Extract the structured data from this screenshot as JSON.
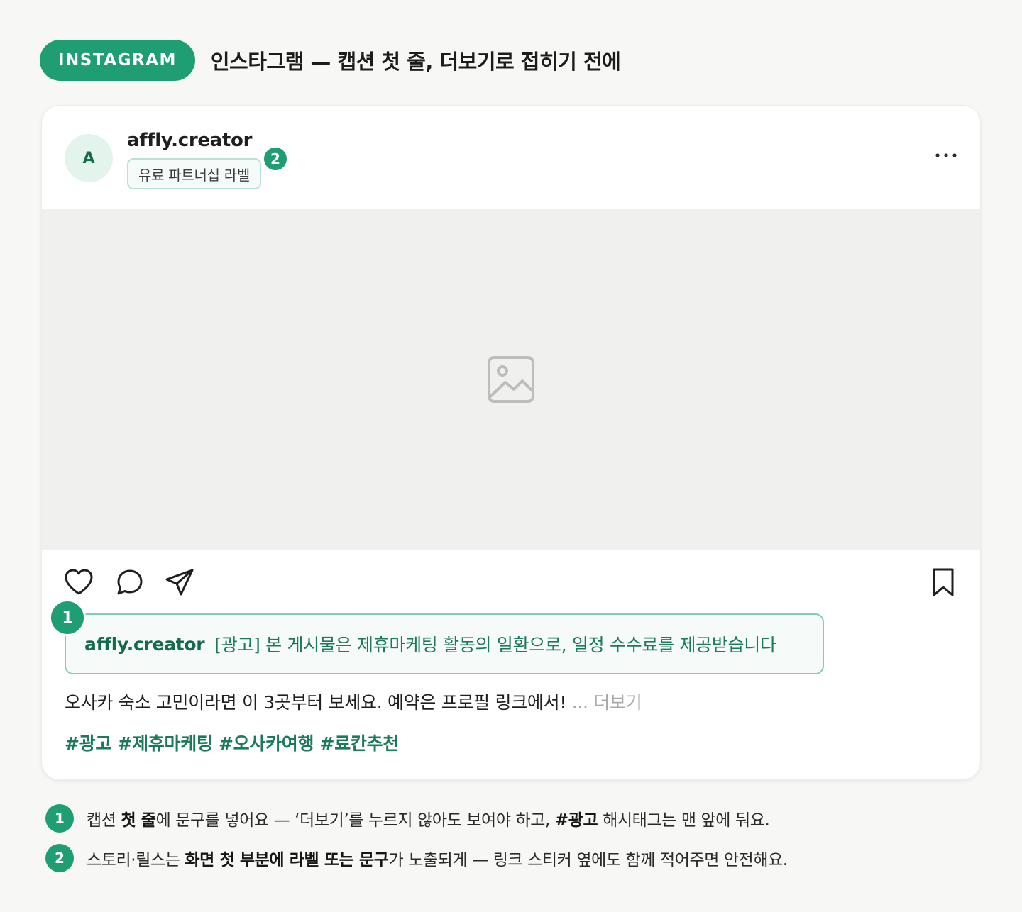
{
  "header": {
    "platform": "INSTAGRAM",
    "title": "인스타그램 — 캡션 첫 줄, 더보기로 접히기 전에"
  },
  "post": {
    "avatar_initial": "A",
    "username": "affly.creator",
    "partner_label": "유료 파트너십 라벨",
    "caption_username": "affly.creator",
    "caption_ad_text": "[광고] 본 게시물은 제휴마케팅 활동의 일환으로, 일정 수수료를 제공받습니다",
    "body_text": "오사카 숙소 고민이라면 이 3곳부터 보세요. 예약은 프로필 링크에서!",
    "more_link": "... 더보기",
    "hashtags": "#광고 #제휴마케팅 #오사카여행 #료칸추천",
    "icons": [
      "more-icon",
      "image-placeholder-icon",
      "heart-icon",
      "comment-icon",
      "share-icon",
      "bookmark-icon"
    ]
  },
  "badges": {
    "one": "1",
    "two": "2"
  },
  "notes": [
    {
      "number": "1",
      "segments": [
        "캡션 ",
        "첫 줄",
        "에 문구를 넣어요 — ‘더보기’를 누르지 않아도 보여야 하고, ",
        "#광고",
        " 해시태그는 맨 앞에 둬요."
      ]
    },
    {
      "number": "2",
      "segments": [
        "스토리·릴스는 ",
        "화면 첫 부분에 라벨 또는 문구",
        "가 노출되게 — 링크 스티커 옆에도 함께 적어주면 안전해요."
      ]
    }
  ],
  "colors": {
    "accent": "#1e9e72",
    "accent_dark": "#146b4e",
    "caption_border": "#7fd0b2",
    "muted": "#a9a9a9",
    "background": "#f7f7f5"
  }
}
